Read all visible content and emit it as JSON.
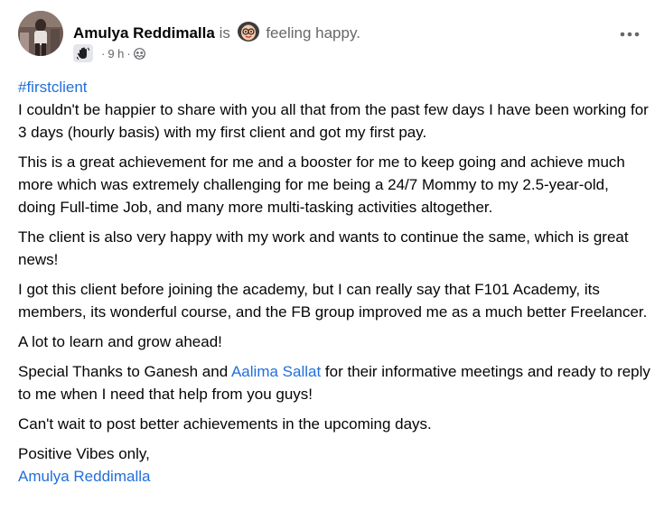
{
  "author": {
    "name": "Amulya Reddimalla",
    "is_text": "is",
    "feeling_text": "feeling happy.",
    "feeling_icon": "happy-face-emoji",
    "avatar_icon": "profile-avatar"
  },
  "meta": {
    "badge_icon": "waving-hand-icon",
    "dot1": "·",
    "time": "9 h",
    "dot2": "·",
    "privacy_icon": "group-members-icon"
  },
  "menu": {
    "more_icon": "three-dots-icon",
    "more_label": "•••"
  },
  "post": {
    "hashtag": "#firstclient",
    "p1": "I couldn't be happier to share with you all that from the past few days I have been working for 3 days (hourly basis) with my first client and got my first pay.",
    "p2": "This is a great achievement for me and a booster for me to keep going and achieve much more which was extremely challenging for me being a 24/7 Mommy to my 2.5-year-old, doing Full-time Job, and many more multi-tasking activities altogether.",
    "p3": "The client is also very happy with my work and wants to continue the same, which is great news!",
    "p4": "I got this client before joining the academy, but I can really say that F101 Academy, its members, its wonderful course, and the FB group improved me as a much better Freelancer.",
    "p5": "A lot to learn and grow ahead!",
    "p6_before": "Special Thanks to Ganesh and ",
    "p6_link": "Aalima Sallat",
    "p6_after": " for their informative meetings and ready to reply to me when I need that help from you guys!",
    "p7": "Can't wait to post better achievements in the upcoming days.",
    "signoff": "Positive Vibes only,",
    "signature_link": "Amulya Reddimalla"
  },
  "colors": {
    "text": "#050505",
    "muted": "#65676b",
    "link": "#216fdb"
  }
}
